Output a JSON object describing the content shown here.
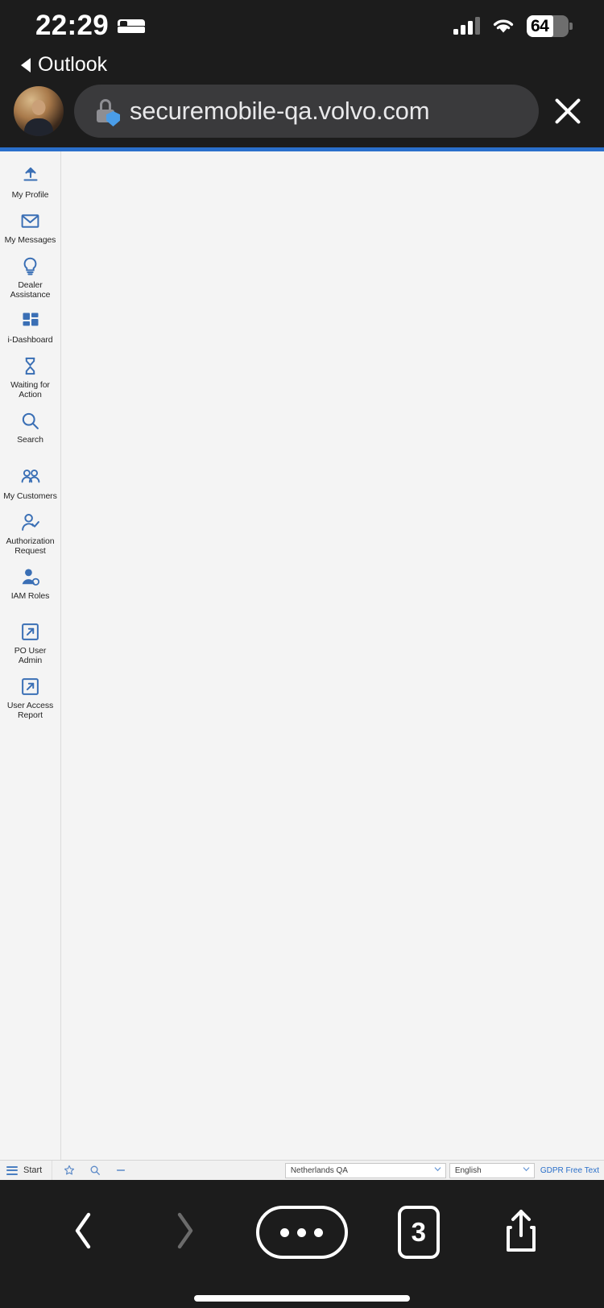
{
  "status_bar": {
    "time": "22:29",
    "sleep_icon": "bed-icon",
    "signal_icon": "cellular-signal-icon",
    "wifi_icon": "wifi-icon",
    "battery_percent": "64"
  },
  "back_to_app": {
    "label": "Outlook",
    "icon": "back-triangle-icon"
  },
  "address_bar": {
    "url": "securemobile-qa.volvo.com",
    "lock_icon": "lock-shield-icon",
    "close_icon": "close-icon",
    "avatar": "profile-avatar"
  },
  "sidebar": {
    "items": [
      {
        "label": "My Profile",
        "icon": "upload-arrow-icon"
      },
      {
        "label": "My Messages",
        "icon": "envelope-icon"
      },
      {
        "label": "Dealer Assistance",
        "icon": "lightbulb-icon"
      },
      {
        "label": "i-Dashboard",
        "icon": "grid-squares-icon"
      },
      {
        "label": "Waiting for Action",
        "icon": "hourglass-icon"
      },
      {
        "label": "Search",
        "icon": "magnifier-icon"
      },
      {
        "label": "My Customers",
        "icon": "two-people-icon"
      },
      {
        "label": "Authorization Request",
        "icon": "person-check-icon"
      },
      {
        "label": "IAM Roles",
        "icon": "person-gear-icon"
      },
      {
        "label": "PO User Admin",
        "icon": "external-link-icon"
      },
      {
        "label": "User Access Report",
        "icon": "external-link-icon"
      }
    ]
  },
  "page_footer": {
    "start_label": "Start",
    "burger_icon": "hamburger-menu-icon",
    "favorite_icon": "star-icon",
    "search_icon": "magnifier-icon",
    "minimize_icon": "minus-icon",
    "country_select": {
      "value": "Netherlands QA",
      "chevron": "chevron-down-icon"
    },
    "language_select": {
      "value": "English",
      "chevron": "chevron-down-icon"
    },
    "gdpr_link": "GDPR Free Text"
  },
  "browser_toolbar": {
    "back_icon": "chevron-left-icon",
    "forward_icon": "chevron-right-icon",
    "more_icon": "ellipsis-icon",
    "tab_count": "3",
    "share_icon": "share-icon"
  },
  "colors": {
    "accent_blue": "#3a6fb5",
    "link_blue": "#2a6fc9",
    "progress_blue": "#2a6fcb",
    "page_bg": "#f4f4f4"
  }
}
